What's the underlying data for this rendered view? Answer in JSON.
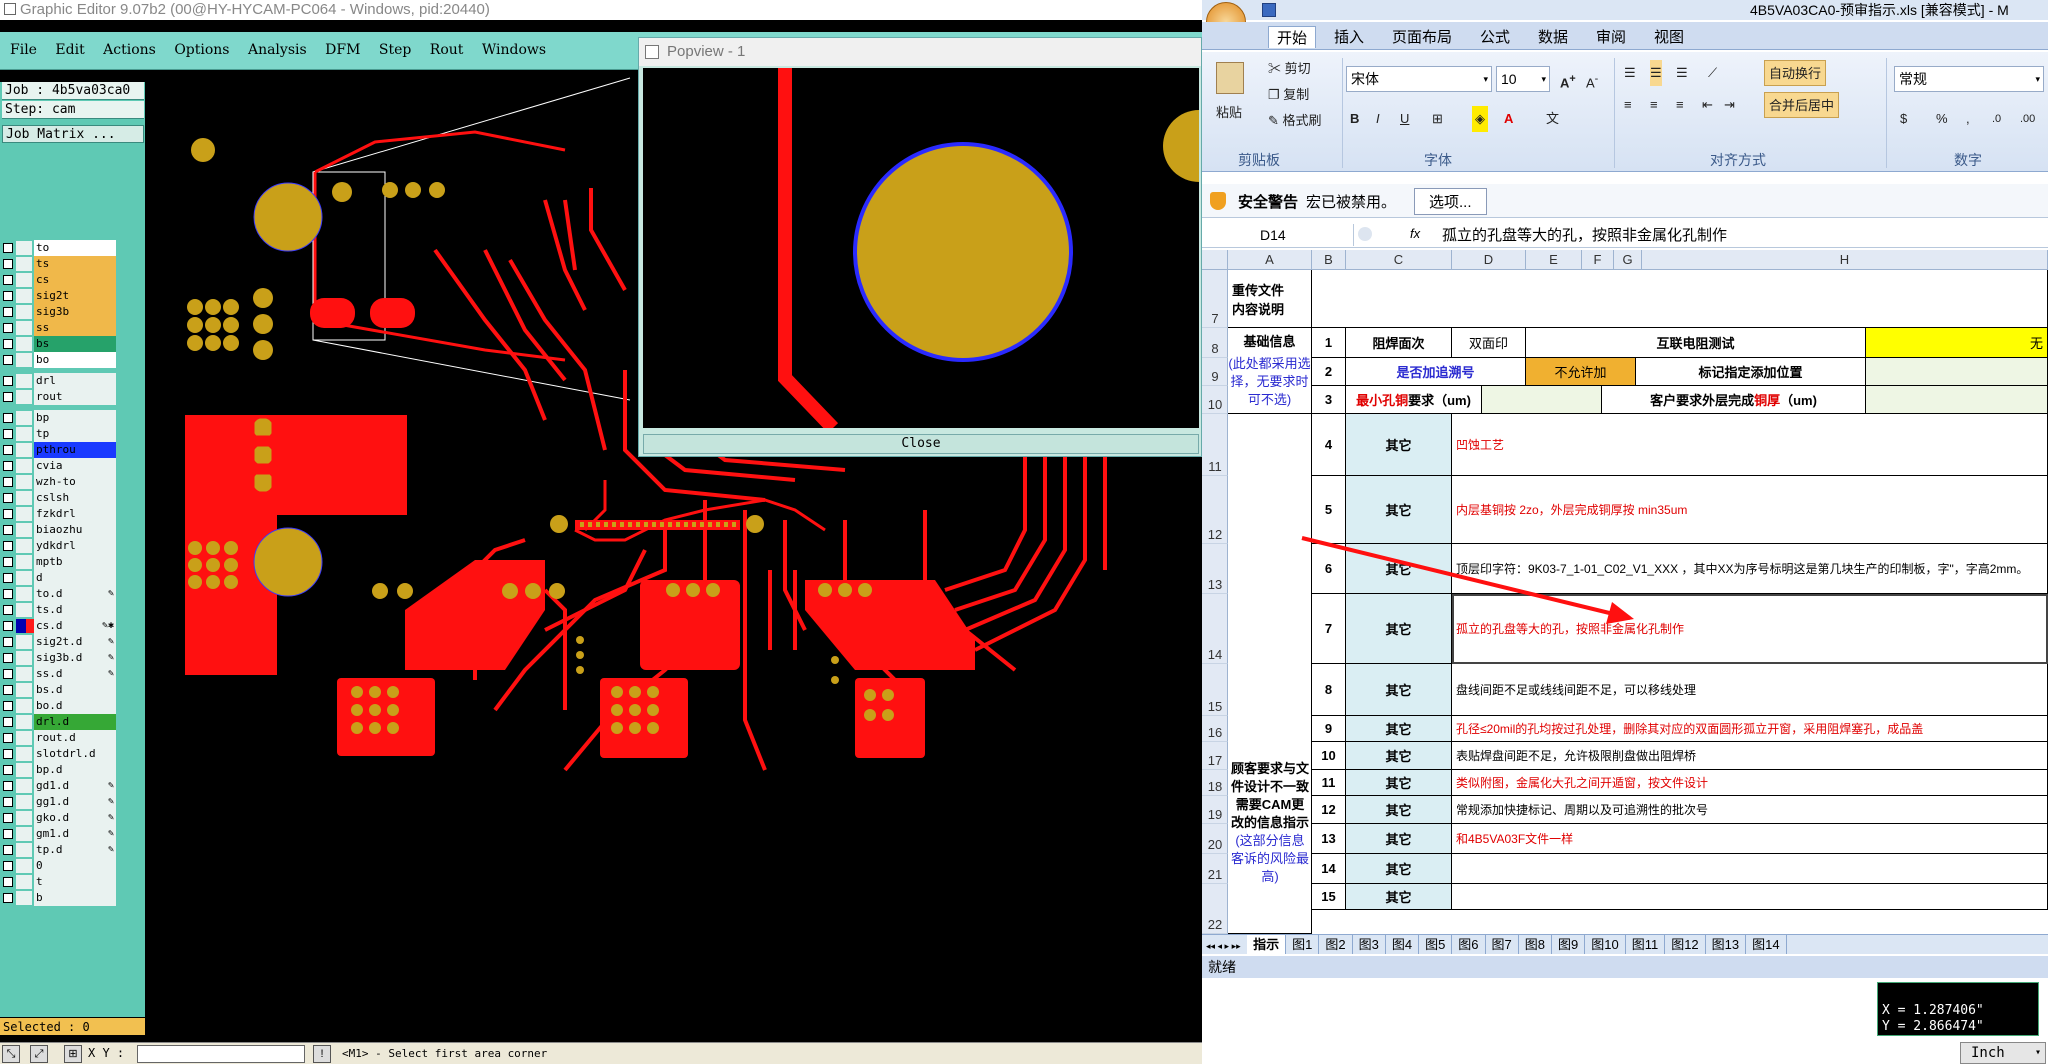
{
  "ge": {
    "title": "Graphic Editor 9.07b2 (00@HY-HYCAM-PC064 - Windows, pid:20440)",
    "menu": [
      "File",
      "Edit",
      "Actions",
      "Options",
      "Analysis",
      "DFM",
      "Step",
      "Rout",
      "Windows"
    ],
    "job_line": "Job : 4b5va03ca0",
    "step_line": "Step: cam",
    "job_matrix": "Job Matrix ...",
    "layers": [
      {
        "name": "to",
        "color": "#ffffff",
        "sel": false
      },
      {
        "name": "ts",
        "color": "#f0b84a",
        "sel": true
      },
      {
        "name": "cs",
        "color": "#f0b84a",
        "sel": false
      },
      {
        "name": "sig2t",
        "color": "#f0b84a",
        "sel": false
      },
      {
        "name": "sig3b",
        "color": "#f0b84a",
        "sel": false
      },
      {
        "name": "ss",
        "color": "#f0b84a",
        "sel": false
      },
      {
        "name": "bs",
        "color": "#26a26a",
        "sel": true
      },
      {
        "name": "bo",
        "color": "#ffffff",
        "sel": false
      },
      {
        "name": "drl",
        "color": "#e9f2f0",
        "sel": false,
        "gap": true
      },
      {
        "name": "rout",
        "color": "#e9f2f0",
        "sel": false
      },
      {
        "name": "bp",
        "color": "#e9f2f0",
        "sel": false,
        "gap": true
      },
      {
        "name": "tp",
        "color": "#e9f2f0",
        "sel": false
      },
      {
        "name": "pthrou",
        "color": "#1a3aff",
        "sel": false
      },
      {
        "name": "cvia",
        "color": "#e9f2f0",
        "sel": false
      },
      {
        "name": "wzh-to",
        "color": "#e9f2f0",
        "sel": false
      },
      {
        "name": "cslsh",
        "color": "#e9f2f0",
        "sel": false
      },
      {
        "name": "fzkdrl",
        "color": "#e9f2f0",
        "sel": false
      },
      {
        "name": "biaozhu",
        "color": "#e9f2f0",
        "sel": false
      },
      {
        "name": "ydkdrl",
        "color": "#e9f2f0",
        "sel": false
      },
      {
        "name": "mptb",
        "color": "#e9f2f0",
        "sel": false
      },
      {
        "name": "d",
        "color": "#e9f2f0",
        "sel": false
      },
      {
        "name": "to.d",
        "color": "#e9f2f0",
        "sel": false,
        "mark": "✎"
      },
      {
        "name": "ts.d",
        "color": "#e9f2f0",
        "sel": false
      },
      {
        "name": "cs.d",
        "color": "#ff1a1a",
        "sel": false,
        "mark": "✎✱",
        "pin": "#0000b0"
      },
      {
        "name": "sig2t.d",
        "color": "#e9f2f0",
        "sel": false,
        "mark": "✎"
      },
      {
        "name": "sig3b.d",
        "color": "#e9f2f0",
        "sel": false,
        "mark": "✎"
      },
      {
        "name": "ss.d",
        "color": "#e9f2f0",
        "sel": false,
        "mark": "✎"
      },
      {
        "name": "bs.d",
        "color": "#e9f2f0",
        "sel": false
      },
      {
        "name": "bo.d",
        "color": "#e9f2f0",
        "sel": false
      },
      {
        "name": "drl.d",
        "color": "#36a836",
        "sel": false
      },
      {
        "name": "rout.d",
        "color": "#e9f2f0",
        "sel": false
      },
      {
        "name": "slotdrl.d",
        "color": "#e9f2f0",
        "sel": false
      },
      {
        "name": "bp.d",
        "color": "#e9f2f0",
        "sel": false
      },
      {
        "name": "gd1.d",
        "color": "#e9f2f0",
        "sel": false,
        "mark": "✎"
      },
      {
        "name": "gg1.d",
        "color": "#e9f2f0",
        "sel": false,
        "mark": "✎"
      },
      {
        "name": "gko.d",
        "color": "#e9f2f0",
        "sel": false,
        "mark": "✎"
      },
      {
        "name": "gm1.d",
        "color": "#e9f2f0",
        "sel": false,
        "mark": "✎"
      },
      {
        "name": "tp.d",
        "color": "#e9f2f0",
        "sel": false,
        "mark": "✎"
      },
      {
        "name": "0",
        "color": "#e9f2f0",
        "sel": false
      },
      {
        "name": "t",
        "color": "#e9f2f0",
        "sel": false
      },
      {
        "name": "b",
        "color": "#e9f2f0",
        "sel": false
      }
    ],
    "selected": "Selected : 0",
    "xy_label": "X Y :",
    "status_msg": "<M1> - Select first area corner",
    "coord_x": "X = 1.287406\"",
    "coord_y": "Y = 2.866474\"",
    "units": "Inch"
  },
  "popview": {
    "title": "Popview - 1",
    "close": "Close"
  },
  "excel": {
    "title": "4B5VA03CA0-预审指示.xls  [兼容模式] - M",
    "tabs": [
      "开始",
      "插入",
      "页面布局",
      "公式",
      "数据",
      "审阅",
      "视图"
    ],
    "clipboard": {
      "paste": "粘贴",
      "cut": "剪切",
      "copy": "复制",
      "format_painter": "格式刷",
      "group": "剪贴板"
    },
    "font": {
      "name": "宋体",
      "size": "10",
      "group": "字体"
    },
    "align": {
      "wrap": "自动换行",
      "merge": "合并后居中",
      "group": "对齐方式"
    },
    "number": {
      "format": "常规",
      "pct": "%",
      "group": "数字"
    },
    "security": {
      "label": "安全警告",
      "text": "宏已被禁用。",
      "button": "选项..."
    },
    "name_box": "D14",
    "fx": "fx",
    "formula": "孤立的孔盘等大的孔，按照非金属化孔制作",
    "columns": [
      "A",
      "B",
      "C",
      "D",
      "E",
      "F",
      "G",
      "H"
    ],
    "rows": [
      "7",
      "8",
      "9",
      "10",
      "11",
      "12",
      "13",
      "14",
      "15",
      "16",
      "17",
      "18",
      "19",
      "20",
      "21",
      "22"
    ],
    "header_label": "重传文件\n内容说明",
    "basic_info": "基础信息",
    "basic_hint": "(此处都采用选择，无要求时可不选)",
    "r1": {
      "no": "1",
      "label": "阻焊面次",
      "value": "双面印",
      "label2": "互联电阻测试",
      "value2": "无"
    },
    "r2": {
      "no": "2",
      "label": "是否加追溯号",
      "value": "不允许加",
      "label2": "标记指定添加位置"
    },
    "r3": {
      "no": "3",
      "label_red": "最小孔铜",
      "label_rest": "要求（um)",
      "label2a": "客户要求外层完成",
      "label2b": "铜厚",
      "label2c": "（um)"
    },
    "mismatch_title": "顾客要求与文件设计不一致需要CAM更改的信息指示",
    "mismatch_hint": "(这部分信息客诉的风险最高)",
    "other": "其它",
    "items": [
      {
        "no": "4",
        "text": "凹蚀工艺",
        "red": true
      },
      {
        "no": "5",
        "text": "内层基铜按 2zo，外层完成铜厚按 min35um",
        "red": true
      },
      {
        "no": "6",
        "text": "顶层印字符：9K03-7_1-01_C02_V1_XXX ，其中XX为序号标明这是第几块生产的印制板，字\"，字高2mm。",
        "red": false
      },
      {
        "no": "7",
        "text": "孤立的孔盘等大的孔，按照非金属化孔制作",
        "red": true
      },
      {
        "no": "8",
        "text": "盘线间距不足或线线间距不足，可以移线处理",
        "red": false
      },
      {
        "no": "9",
        "text": "孔径≤20mil的孔均按过孔处理，删除其对应的双面圆形孤立开窗，采用阻焊塞孔，成品盖",
        "red": true
      },
      {
        "no": "10",
        "text": "表贴焊盘间距不足，允许极限削盘做出阻焊桥",
        "red": false
      },
      {
        "no": "11",
        "text": "类似附图，金属化大孔之间开遁窗，按文件设计",
        "red": true
      },
      {
        "no": "12",
        "text": "常规添加快捷标记、周期以及可追溯性的批次号",
        "red": false
      },
      {
        "no": "13",
        "text": "和4B5VA03F文件一样",
        "red": true
      },
      {
        "no": "14",
        "text": "",
        "red": false
      },
      {
        "no": "15",
        "text": "",
        "red": false
      }
    ],
    "sheets": [
      "指示",
      "图1",
      "图2",
      "图3",
      "图4",
      "图5",
      "图6",
      "图7",
      "图8",
      "图9",
      "图10",
      "图11",
      "图12",
      "图13",
      "图14"
    ],
    "status": "就绪"
  },
  "colors": {
    "trace": "#ff1010",
    "pad": "#c9a019",
    "pad_outline": "#3a3aff",
    "accent_teal": "#5fc9b4"
  }
}
